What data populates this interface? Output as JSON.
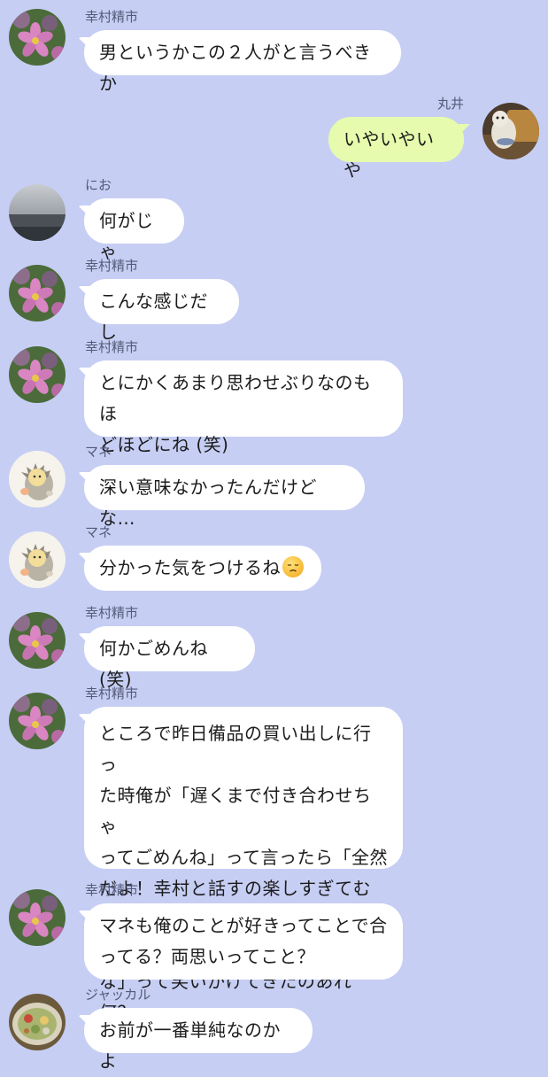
{
  "messages": [
    {
      "side": "left",
      "sender": "幸村精市",
      "avatar": "cosmos-flower-avatar",
      "text": "男というかこの２人がと言うべきか"
    },
    {
      "side": "right",
      "sender": "丸井",
      "avatar": "plush-toy-avatar",
      "text": "いやいやいや"
    },
    {
      "side": "left",
      "sender": "にお",
      "avatar": "sea-horizon-avatar",
      "text": "何がじゃ"
    },
    {
      "side": "left",
      "sender": "幸村精市",
      "avatar": "cosmos-flower-avatar",
      "text": "こんな感じだし"
    },
    {
      "side": "left",
      "sender": "幸村精市",
      "avatar": "cosmos-flower-avatar",
      "text": "とにかくあまり思わせぶりなのもほ\nどほどにね (笑)"
    },
    {
      "side": "left",
      "sender": "マネ",
      "avatar": "hedgehog-illustration-avatar",
      "text": "深い意味なかったんだけどな…"
    },
    {
      "side": "left",
      "sender": "マネ",
      "avatar": "hedgehog-illustration-avatar",
      "text": "分かった気をつけるね",
      "emoji": "disappointed-face"
    },
    {
      "side": "left",
      "sender": "幸村精市",
      "avatar": "cosmos-flower-avatar",
      "text": "何かごめんね (笑)"
    },
    {
      "side": "left",
      "sender": "幸村精市",
      "avatar": "cosmos-flower-avatar",
      "text": "ところで昨日備品の買い出しに行っ\nた時俺が「遅くまで付き合わせちゃ\nってごめんね」って言ったら「全然\nだよ！幸村と話すの楽しすぎてむし\nろ時間経つのあっという間だった\nな」って笑いかけてきたのあれ何？"
    },
    {
      "side": "left",
      "sender": "幸村精市",
      "avatar": "cosmos-flower-avatar",
      "text": "マネも俺のことが好きってことで合\nってる？両思いってこと？"
    },
    {
      "side": "left",
      "sender": "ジャッカル",
      "avatar": "food-plate-avatar",
      "text": "お前が一番単純なのかよ"
    }
  ]
}
